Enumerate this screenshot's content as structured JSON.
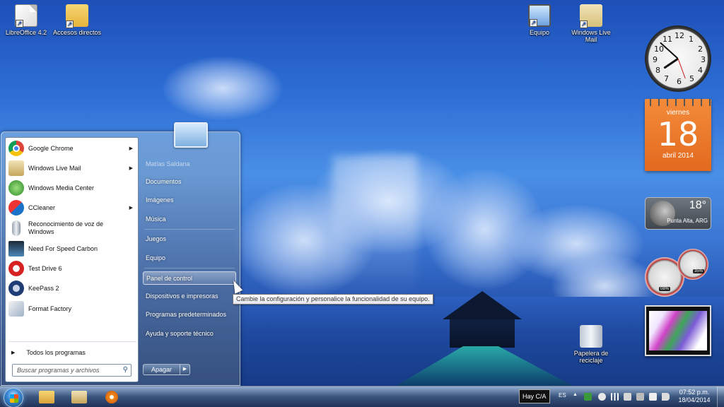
{
  "desktop_icons": [
    {
      "label": "LibreOffice 4.2"
    },
    {
      "label": "Accesos directos"
    },
    {
      "label": "Equipo"
    },
    {
      "label": "Windows Live Mail"
    },
    {
      "label": "Papelera de reciclaje"
    }
  ],
  "gadgets": {
    "clock": {
      "numbers": [
        "12",
        "1",
        "2",
        "3",
        "4",
        "5",
        "6",
        "7",
        "8",
        "9",
        "10",
        "11"
      ],
      "time": "07:52"
    },
    "calendar": {
      "weekday": "viernes",
      "day": "18",
      "month_year": "abril 2014"
    },
    "weather": {
      "temperature": "18°",
      "location": "Punta Alta, ARG"
    },
    "meter": {
      "cpu": "08%",
      "ram": "35%"
    }
  },
  "start_menu": {
    "programs": [
      {
        "label": "Google Chrome",
        "has_submenu": true,
        "icon": "chrome-icon"
      },
      {
        "label": "Windows Live Mail",
        "has_submenu": true,
        "icon": "windows-live-mail-icon"
      },
      {
        "label": "Windows Media Center",
        "has_submenu": false,
        "icon": "media-center-icon"
      },
      {
        "label": "CCleaner",
        "has_submenu": true,
        "icon": "ccleaner-icon"
      },
      {
        "label": "Reconocimiento de voz de Windows",
        "has_submenu": false,
        "icon": "microphone-icon"
      },
      {
        "label": "Need For Speed Carbon",
        "has_submenu": false,
        "icon": "nfs-icon"
      },
      {
        "label": "Test Drive 6",
        "has_submenu": false,
        "icon": "test-drive-icon"
      },
      {
        "label": "KeePass 2",
        "has_submenu": false,
        "icon": "keepass-icon"
      },
      {
        "label": "Format Factory",
        "has_submenu": false,
        "icon": "format-factory-icon"
      }
    ],
    "all_programs": "Todos los programas",
    "search_placeholder": "Buscar programas y archivos",
    "user_name": "Matías Saldana",
    "right_items": [
      "Documentos",
      "Imágenes",
      "Música",
      "Juegos",
      "Equipo",
      "Panel de control",
      "Dispositivos e impresoras",
      "Programas predeterminados",
      "Ayuda y soporte técnico"
    ],
    "highlighted_item": "Panel de control",
    "shutdown_label": "Apagar"
  },
  "tooltip": "Cambie la configuración y personalice la funcionalidad de su equipo.",
  "taskbar": {
    "notification": "Hay C/A",
    "language": "ES",
    "time": "07:52 p.m.",
    "date": "18/04/2014"
  },
  "colors": {
    "calendar": "#e3691f",
    "taskbar": "#1e3a6a",
    "highlight": "#ffffff"
  }
}
